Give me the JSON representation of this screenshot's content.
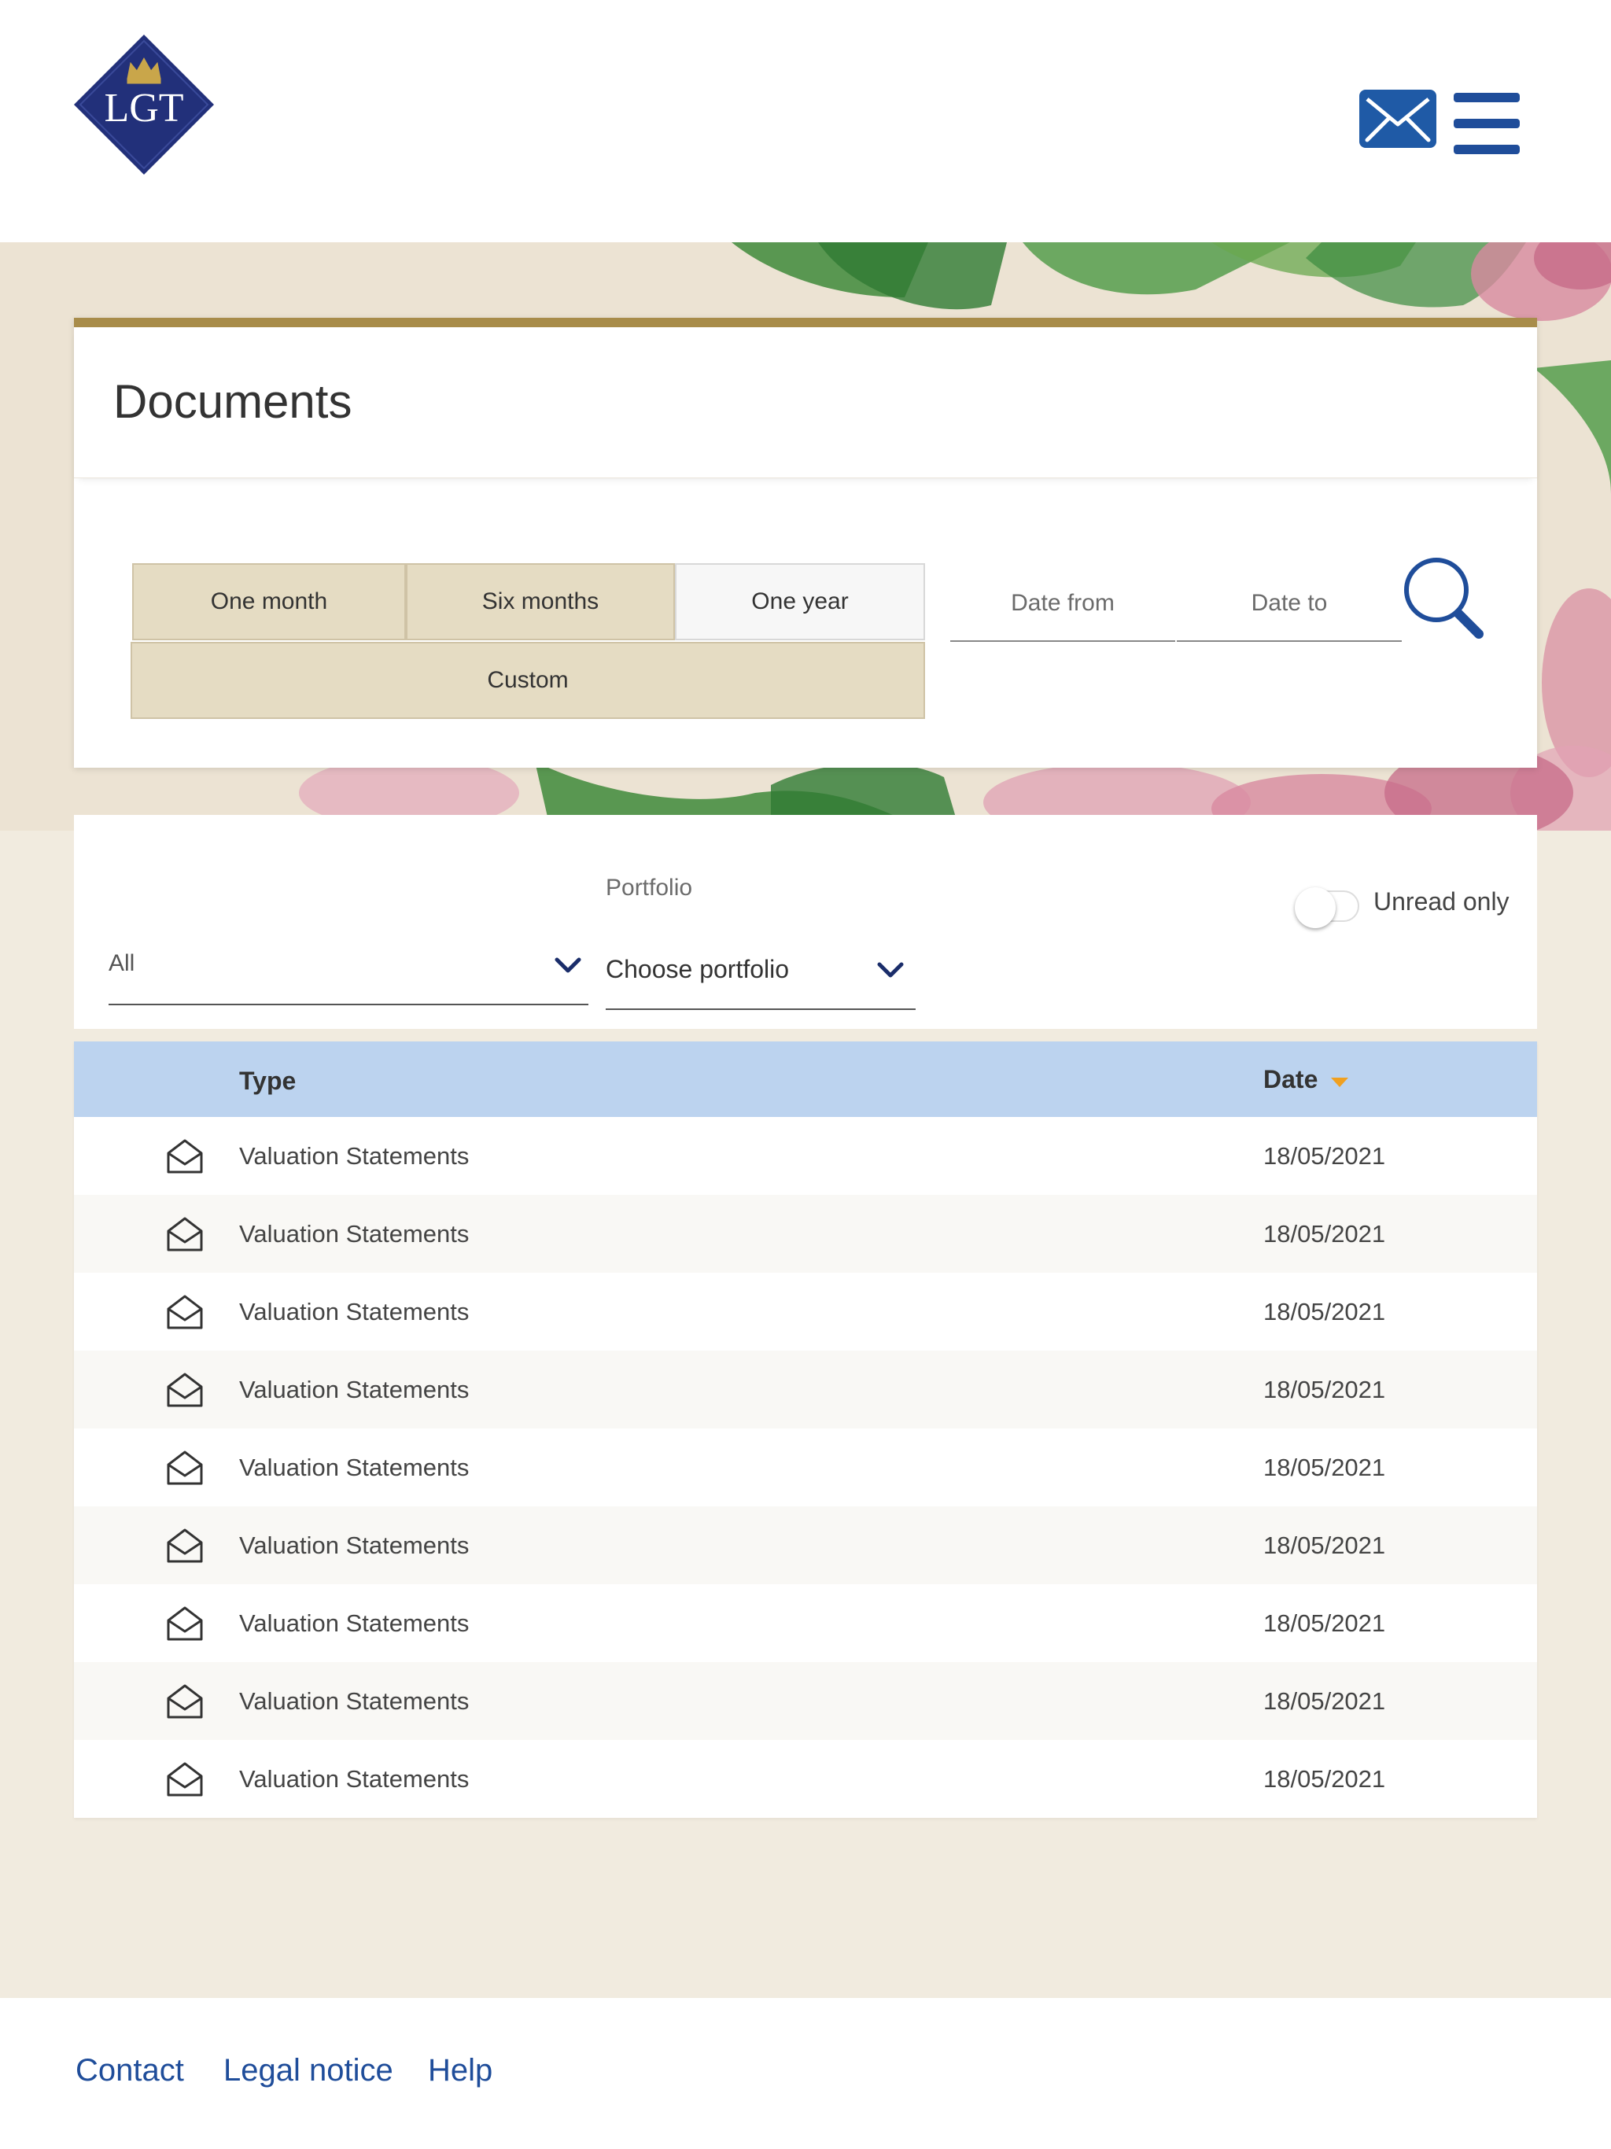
{
  "brand": {
    "logo_text": "LGT",
    "primary_color": "#1f3d8a",
    "accent_gold": "#a88c4a"
  },
  "header": {
    "mail_icon": "envelope-icon",
    "menu_icon": "hamburger-menu-icon"
  },
  "documents": {
    "title": "Documents",
    "periods": [
      {
        "label": "One month",
        "active": false
      },
      {
        "label": "Six months",
        "active": false
      },
      {
        "label": "One year",
        "active": true
      },
      {
        "label": "Custom",
        "active": false
      }
    ],
    "date_from_placeholder": "Date from",
    "date_to_placeholder": "Date to",
    "search_icon": "search-icon"
  },
  "filters": {
    "type_value": "All",
    "portfolio_label": "Portfolio",
    "portfolio_value": "Choose portfolio",
    "unread_label": "Unread only",
    "unread_on": false
  },
  "table": {
    "col_type": "Type",
    "col_date": "Date",
    "sort": "date-descending",
    "rows": [
      {
        "type": "Valuation Statements",
        "date": "18/05/2021",
        "icon": "open-envelope-icon"
      },
      {
        "type": "Valuation Statements",
        "date": "18/05/2021",
        "icon": "open-envelope-icon"
      },
      {
        "type": "Valuation Statements",
        "date": "18/05/2021",
        "icon": "open-envelope-icon"
      },
      {
        "type": "Valuation Statements",
        "date": "18/05/2021",
        "icon": "open-envelope-icon"
      },
      {
        "type": "Valuation Statements",
        "date": "18/05/2021",
        "icon": "open-envelope-icon"
      },
      {
        "type": "Valuation Statements",
        "date": "18/05/2021",
        "icon": "open-envelope-icon"
      },
      {
        "type": "Valuation Statements",
        "date": "18/05/2021",
        "icon": "open-envelope-icon"
      },
      {
        "type": "Valuation Statements",
        "date": "18/05/2021",
        "icon": "open-envelope-icon"
      },
      {
        "type": "Valuation Statements",
        "date": "18/05/2021",
        "icon": "open-envelope-icon"
      }
    ]
  },
  "footer": {
    "links": [
      "Contact",
      "Legal notice",
      "Help"
    ]
  }
}
